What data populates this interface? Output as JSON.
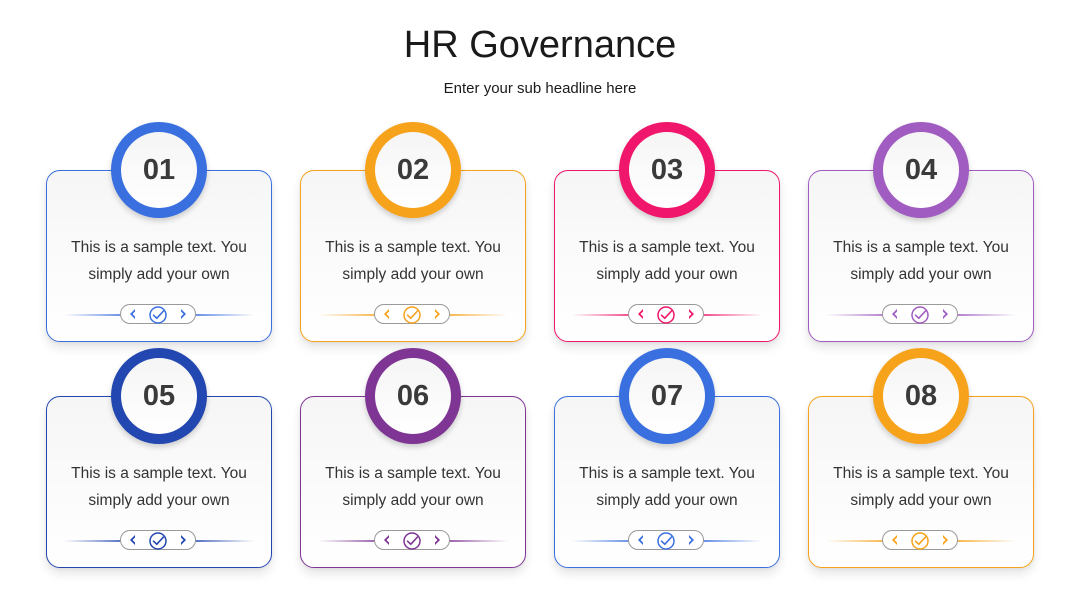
{
  "header": {
    "title": "HR Governance",
    "subtitle": "Enter your sub headline here"
  },
  "cards": [
    {
      "number": "01",
      "color": "#3a6fe0",
      "text_line1": "This is a sample text. You",
      "text_line2": "simply add your own"
    },
    {
      "number": "02",
      "color": "#f7a21b",
      "text_line1": "This is a sample text. You",
      "text_line2": "simply add your own"
    },
    {
      "number": "03",
      "color": "#f0166b",
      "text_line1": "This is a sample text. You",
      "text_line2": "simply add your own"
    },
    {
      "number": "04",
      "color": "#a05cc0",
      "text_line1": "This is a sample text. You",
      "text_line2": "simply add your own"
    },
    {
      "number": "05",
      "color": "#2347b0",
      "text_line1": "This is a sample text. You",
      "text_line2": "simply add your own"
    },
    {
      "number": "06",
      "color": "#7e3593",
      "text_line1": "This is a sample text. You",
      "text_line2": "simply add your own"
    },
    {
      "number": "07",
      "color": "#3a6fe0",
      "text_line1": "This is a sample text. You",
      "text_line2": "simply add your own"
    },
    {
      "number": "08",
      "color": "#f7a21b",
      "text_line1": "This is a sample text. You",
      "text_line2": "simply add your own"
    }
  ],
  "icons": {
    "left": "chevron-left-icon",
    "check": "check-circle-icon",
    "right": "chevron-right-icon"
  }
}
